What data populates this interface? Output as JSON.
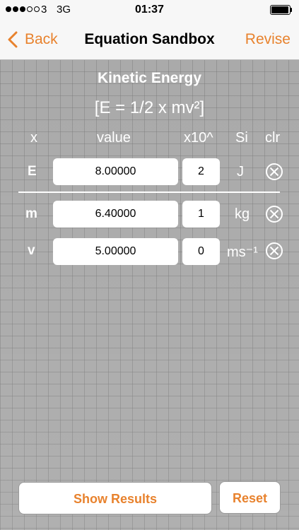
{
  "status_bar": {
    "carrier": "3",
    "network": "3G",
    "time": "01:37"
  },
  "nav": {
    "back_label": "Back",
    "title": "Equation Sandbox",
    "revise_label": "Revise"
  },
  "equation": {
    "name": "Kinetic Energy",
    "formula": "[E = 1/2 x mv²]"
  },
  "columns": {
    "variable": "x",
    "value": "value",
    "exponent": "x10^",
    "si": "Si",
    "clear": "clr"
  },
  "rows": [
    {
      "variable": "E",
      "value": "8.00000",
      "exponent": "2",
      "unit": "J"
    },
    {
      "variable": "m",
      "value": "6.40000",
      "exponent": "1",
      "unit": "kg"
    },
    {
      "variable": "v",
      "value": "5.00000",
      "exponent": "0",
      "unit": "ms⁻¹"
    }
  ],
  "actions": {
    "show_results": "Show Results",
    "reset": "Reset"
  },
  "colors": {
    "accent": "#e8822d",
    "grid_background": "#a9a9a9",
    "bar_background": "#f7f7f7"
  },
  "icons": {
    "back": "chevron-left-icon",
    "clear": "circle-x-icon"
  }
}
